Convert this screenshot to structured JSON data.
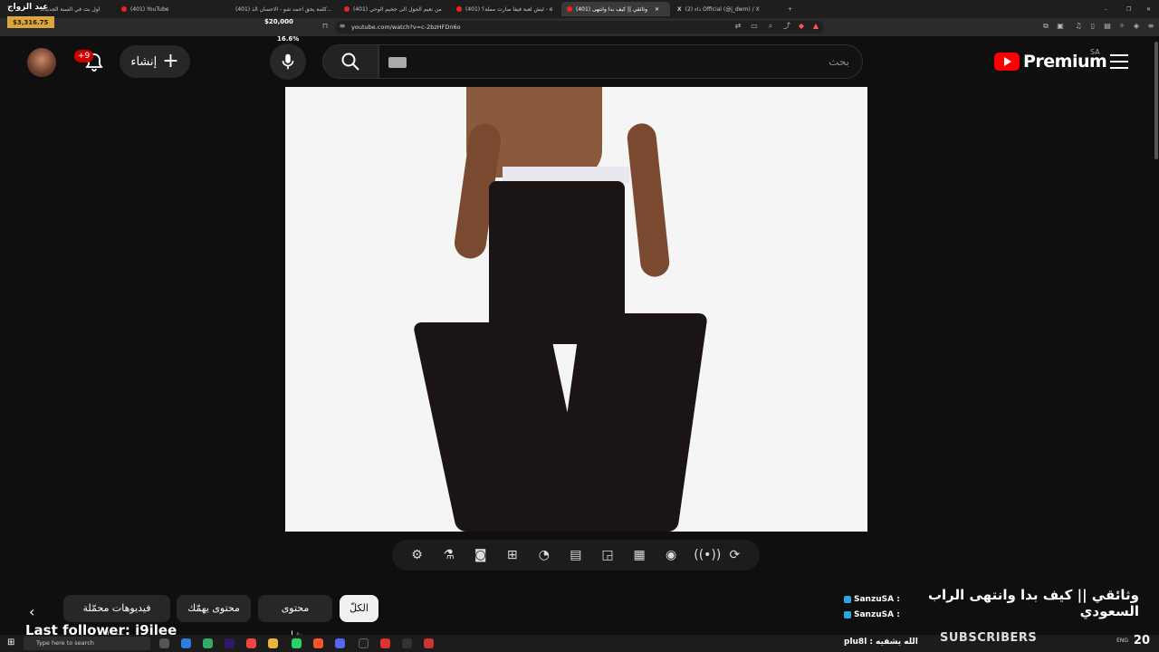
{
  "stream_overlay": {
    "title": "عيد الزواج",
    "money_total": "$3,316.75",
    "money_goal": "$20,000",
    "percent": "16.6%",
    "last_follower": "Last follower: i9ilee",
    "subscribers_label": "SUBSCRIBERS",
    "sub_count": "20"
  },
  "browser": {
    "tabs": [
      {
        "label": "اول بث في السنة الجديدة",
        "active": false
      },
      {
        "label": "(401) YouTube",
        "active": false
      },
      {
        "label": "(401) كلمة يحق احمد شو - الاحسان الذ...",
        "active": false
      },
      {
        "label": "(401) من نعيم الجول الى جحيم الوحي",
        "active": false
      },
      {
        "label": "(401) ليش لعبة فيفا صارت مملة؟ - e",
        "active": false
      },
      {
        "label": "(401) وثائقي || كيف بدا وانتهى",
        "active": true
      },
      {
        "label": "(2) ذاء Official (@j_dwm) / X",
        "active": false
      }
    ],
    "url": "youtube.com/watch?v=c-2bzHFDn6o"
  },
  "header": {
    "notification_badge": "+9",
    "create_label": "إنشاء",
    "search_placeholder": "بحث",
    "logo_text": "Premium",
    "logo_country": "SA"
  },
  "player_tools": [
    "gear-icon",
    "flask-icon",
    "camera-icon",
    "add-clip-icon",
    "speed-icon",
    "subtitles-icon",
    "pip-icon",
    "clapper-icon",
    "watch-later-icon",
    "broadcast-icon",
    "loop-icon"
  ],
  "video": {
    "title": "وثائقي || كيف بدا وانتهى الراب السعودي"
  },
  "chips": [
    {
      "label": "الكلّ",
      "active": true
    },
    {
      "label": "محتوى مشابه",
      "active": false
    },
    {
      "label": "محتوى يهمّك",
      "active": false
    },
    {
      "label": "فيديوهات محمّلة حديثًا",
      "active": false
    }
  ],
  "chat": [
    {
      "user": "SanzuSA :",
      "message": ""
    },
    {
      "user": "SanzuSA :",
      "message": ""
    },
    {
      "user": "plu8l :",
      "message": "الله يشفيه"
    }
  ],
  "taskbar": {
    "search_placeholder": "Type here to search",
    "language": "ENG"
  }
}
